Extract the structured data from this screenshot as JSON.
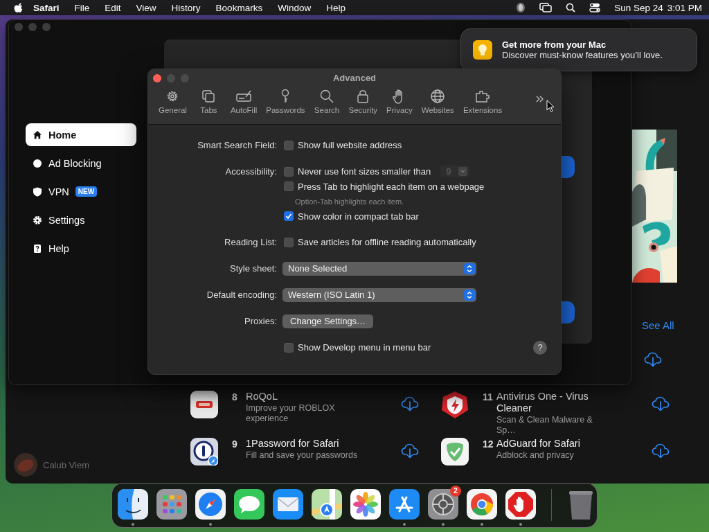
{
  "menu_bar": {
    "app": "Safari",
    "menus": [
      "File",
      "Edit",
      "View",
      "History",
      "Bookmarks",
      "Window",
      "Help"
    ],
    "date": "Sun Sep 24",
    "time": "3:01 PM"
  },
  "notification": {
    "title": "Get more from your Mac",
    "body": "Discover must-know features you’ll love."
  },
  "app_window": {
    "sidebar": [
      {
        "kind": "home",
        "label": "Home",
        "selected": true
      },
      {
        "kind": "dot",
        "label": "Ad Blocking",
        "selected": false
      },
      {
        "kind": "shield",
        "label": "VPN",
        "selected": false,
        "badge": "NEW"
      },
      {
        "kind": "gear",
        "label": "Settings",
        "selected": false
      },
      {
        "kind": "help",
        "label": "Help",
        "selected": false
      }
    ],
    "user": "Calub Viem",
    "see_all": "See All",
    "apps": [
      {
        "kind": "roqol",
        "rank": "8",
        "name": "RoQoL",
        "subtitle": "Improve your ROBLOX experience"
      },
      {
        "kind": "antivirus",
        "rank": "11",
        "name": "Antivirus One - Virus Cleaner",
        "subtitle": "Scan & Clean Malware & Sp…"
      },
      {
        "kind": "password",
        "rank": "9",
        "name": "1Password for Safari",
        "subtitle": "Fill and save your passwords"
      },
      {
        "kind": "adguard",
        "rank": "12",
        "name": "AdGuard for Safari",
        "subtitle": "Adblock and privacy"
      }
    ]
  },
  "settings": {
    "title": "Advanced",
    "toolbar": [
      {
        "kind": "gear",
        "label": "General"
      },
      {
        "kind": "tabs",
        "label": "Tabs"
      },
      {
        "kind": "autofill",
        "label": "AutoFill"
      },
      {
        "kind": "key",
        "label": "Passwords"
      },
      {
        "kind": "search",
        "label": "Search"
      },
      {
        "kind": "lock",
        "label": "Security"
      },
      {
        "kind": "hand",
        "label": "Privacy"
      },
      {
        "kind": "globe",
        "label": "Websites"
      },
      {
        "kind": "puzzle",
        "label": "Extensions"
      }
    ],
    "sections": [
      {
        "label": "Smart Search Field:",
        "controls": [
          {
            "kind": "checkbox",
            "text": "Show full website address",
            "checked": false
          }
        ]
      },
      {
        "label": "Accessibility:",
        "controls": [
          {
            "kind": "checkbox",
            "text": "Never use font sizes smaller than",
            "checked": false,
            "stepper": {
              "value": "9",
              "disabled": true
            }
          },
          {
            "kind": "checkbox",
            "text": "Press Tab to highlight each item on a webpage",
            "checked": false
          },
          {
            "kind": "note",
            "text": "Option-Tab highlights each item."
          },
          {
            "kind": "checkbox",
            "text": "Show color in compact tab bar",
            "checked": true
          }
        ]
      },
      {
        "label": "Reading List:",
        "controls": [
          {
            "kind": "checkbox",
            "text": "Save articles for offline reading automatically",
            "checked": false
          }
        ]
      },
      {
        "label": "Style sheet:",
        "controls": [
          {
            "kind": "select",
            "value": "None Selected"
          }
        ]
      },
      {
        "label": "Default encoding:",
        "controls": [
          {
            "kind": "select",
            "value": "Western (ISO Latin 1)"
          }
        ]
      },
      {
        "label": "Proxies:",
        "controls": [
          {
            "kind": "button",
            "text": "Change Settings…"
          }
        ]
      },
      {
        "controls": [
          {
            "kind": "checkbox",
            "text": "Show Develop menu in menu bar",
            "checked": false,
            "help": "?"
          }
        ]
      }
    ]
  },
  "dock": [
    {
      "kind": "finder",
      "running": true
    },
    {
      "kind": "launchpad",
      "running": false
    },
    {
      "kind": "safari",
      "running": true
    },
    {
      "kind": "messages",
      "running": false
    },
    {
      "kind": "mail",
      "running": false
    },
    {
      "kind": "maps",
      "running": false
    },
    {
      "kind": "photos",
      "running": false
    },
    {
      "kind": "appstore",
      "running": true
    },
    {
      "kind": "settings",
      "running": true,
      "badge": "2"
    },
    {
      "kind": "chrome",
      "running": true
    },
    {
      "kind": "adblock",
      "running": true
    },
    {
      "kind": "trash",
      "running": false
    }
  ]
}
